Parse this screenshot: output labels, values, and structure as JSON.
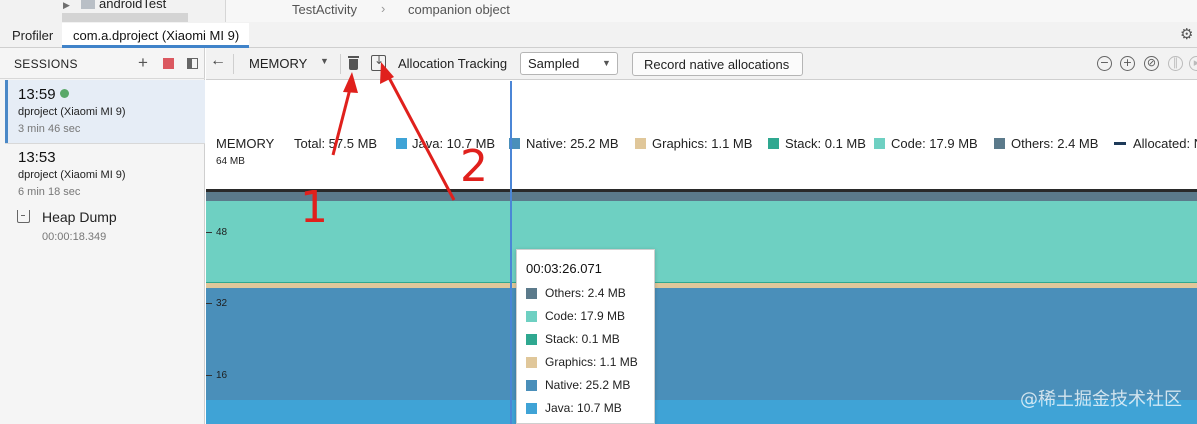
{
  "project_tree": {
    "item_label": "androidTest"
  },
  "editor": {
    "breadcrumb_1": "TestActivity",
    "breadcrumb_sep": "›",
    "breadcrumb_2": "companion object"
  },
  "tabs": {
    "profiler": "Profiler",
    "device": "com.a.dproject (Xiaomi MI 9)"
  },
  "sessions": {
    "title": "SESSIONS",
    "items": [
      {
        "time": "13:59",
        "name": "dproject (Xiaomi MI 9)",
        "duration": "3 min 46 sec",
        "live": true
      },
      {
        "time": "13:53",
        "name": "dproject (Xiaomi MI 9)",
        "duration": "6 min 18 sec",
        "live": false
      }
    ],
    "heap_dump": {
      "title": "Heap Dump",
      "time": "00:00:18.349"
    }
  },
  "toolbar": {
    "profiler_select": "MEMORY",
    "allocation_tracking_label": "Allocation Tracking",
    "allocation_mode": "Sampled",
    "record_native_label": "Record native allocations"
  },
  "legend": {
    "title": "MEMORY",
    "total": "Total: 57.5 MB",
    "java": "Java: 10.7 MB",
    "native": "Native: 25.2 MB",
    "graphics": "Graphics: 1.1 MB",
    "stack": "Stack: 0.1 MB",
    "code": "Code: 17.9 MB",
    "others": "Others: 2.4 MB",
    "allocated": "Allocated: N"
  },
  "axis": {
    "top": "64 MB",
    "t48": "48",
    "t32": "32",
    "t16": "16"
  },
  "tooltip": {
    "time": "00:03:26.071",
    "rows": [
      {
        "label": "Others: 2.4 MB",
        "color": "#5b7a8b"
      },
      {
        "label": "Code: 17.9 MB",
        "color": "#6ed0c2"
      },
      {
        "label": "Stack: 0.1 MB",
        "color": "#2fa890"
      },
      {
        "label": "Graphics: 1.1 MB",
        "color": "#e0c79a"
      },
      {
        "label": "Native: 25.2 MB",
        "color": "#4a8fba"
      },
      {
        "label": "Java: 10.7 MB",
        "color": "#3fa3d6"
      }
    ]
  },
  "colors": {
    "java": "#3fa3d6",
    "native": "#4a8fba",
    "graphics": "#e0c79a",
    "stack": "#2fa890",
    "code": "#6ed0c2",
    "others": "#5b7a8b",
    "accent": "#4083c9",
    "annotation": "#e0201c"
  },
  "annotations": {
    "one": "1",
    "two": "2"
  },
  "watermark": "@稀土掘金技术社区"
}
